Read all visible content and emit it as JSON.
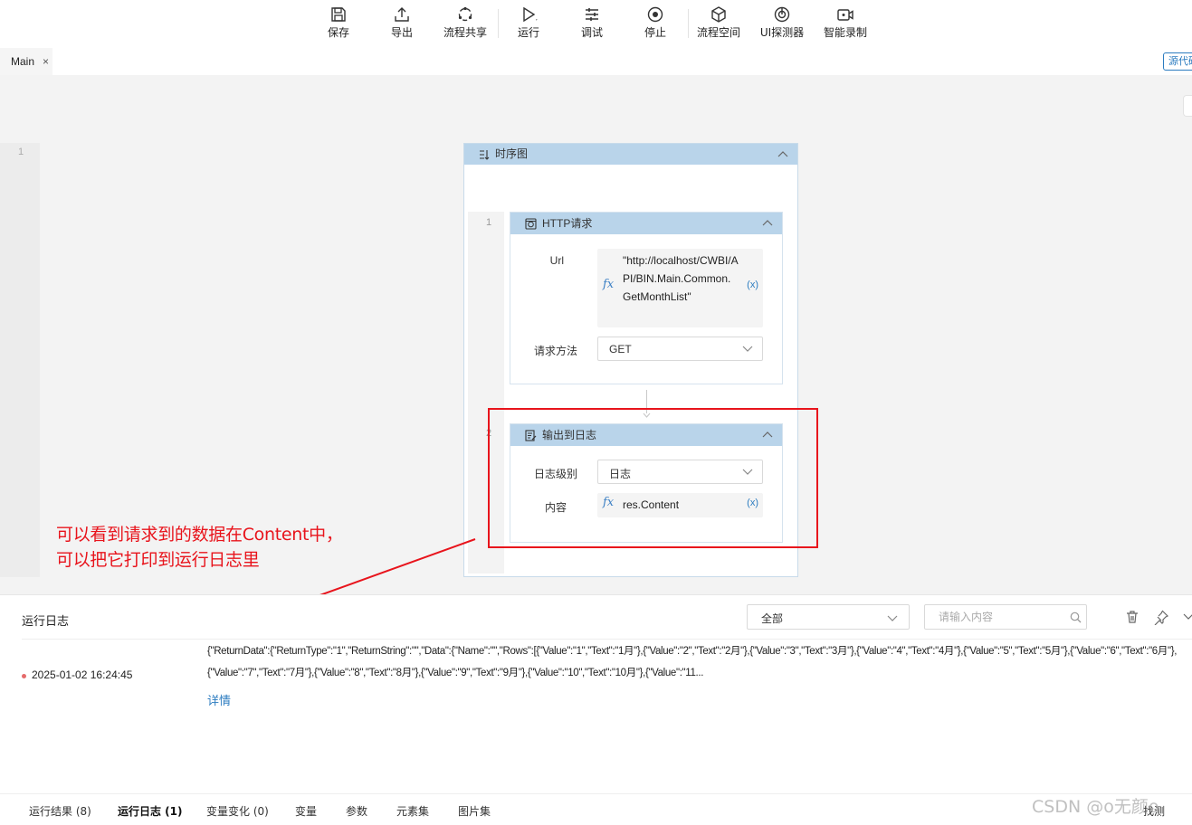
{
  "toolbar": {
    "save": "保存",
    "export": "导出",
    "share": "流程共享",
    "run": "运行",
    "debug": "调试",
    "stop": "停止",
    "space": "流程空间",
    "ui_probe": "UI探测器",
    "record": "智能录制"
  },
  "tabs": {
    "main_label": "Main",
    "close": "×",
    "source_button": "源代码"
  },
  "canvas": {
    "line_number": "1",
    "sequence": {
      "title": "时序图",
      "inner_line_1": "1",
      "inner_line_2": "2",
      "http": {
        "title": "HTTP请求",
        "url_label": "Url",
        "fx": "fx",
        "url_value": "\"http://localhost/CWBI/API/BIN.Main.Common.GetMonthList\"",
        "var_button": "(x)",
        "method_label": "请求方法",
        "method_value": "GET"
      },
      "log_out": {
        "title": "输出到日志",
        "level_label": "日志级别",
        "level_value": "日志",
        "content_label": "内容",
        "fx": "fx",
        "content_value": "res.Content",
        "var_button": "(x)"
      }
    },
    "annotation_line1": "可以看到请求到的数据在Content中，",
    "annotation_line2": "可以把它打印到运行日志里"
  },
  "log": {
    "title": "运行日志",
    "filter_value": "全部",
    "search_placeholder": "请输入内容",
    "entry": {
      "timestamp": "2025-01-02 16:24:45",
      "message": "{\"ReturnData\":{\"ReturnType\":\"1\",\"ReturnString\":\"\",\"Data\":{\"Name\":\"\",\"Rows\":[{\"Value\":\"1\",\"Text\":\"1月\"},{\"Value\":\"2\",\"Text\":\"2月\"},{\"Value\":\"3\",\"Text\":\"3月\"},{\"Value\":\"4\",\"Text\":\"4月\"},{\"Value\":\"5\",\"Text\":\"5月\"},{\"Value\":\"6\",\"Text\":\"6月\"},{\"Value\":\"7\",\"Text\":\"7月\"},{\"Value\":\"8\",\"Text\":\"8月\"},{\"Value\":\"9\",\"Text\":\"9月\"},{\"Value\":\"10\",\"Text\":\"10月\"},{\"Value\":\"11...",
      "detail_link": "详情"
    }
  },
  "bottom_tabs": {
    "results": "运行结果 (8)",
    "run_log": "运行日志 (1)",
    "var_changes": "变量变化 (0)",
    "variables": "变量",
    "params": "参数",
    "elements": "元素集",
    "images": "图片集",
    "right": "找测"
  },
  "watermark": "CSDN @o无颜o",
  "colors": {
    "accent": "#2c7cc0",
    "header_blue": "#b9d4ea",
    "annotation_red": "#e8141c"
  }
}
